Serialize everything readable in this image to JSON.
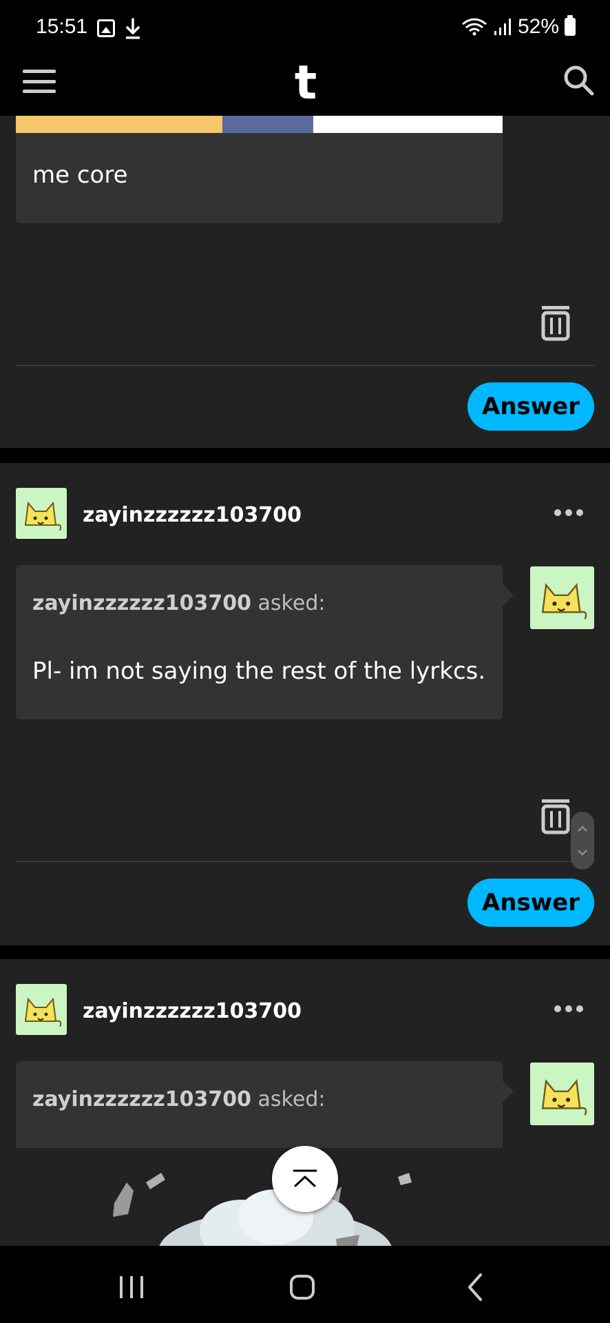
{
  "status_bar": {
    "time": "15:51",
    "battery": "52%",
    "icons": [
      "image-icon",
      "download-icon",
      "wifi-icon",
      "signal-icon",
      "battery-icon"
    ]
  },
  "app_bar": {
    "logo": "t",
    "icons": [
      "menu-icon",
      "tumblr-logo",
      "search-icon"
    ]
  },
  "posts": [
    {
      "text": "me core",
      "answer_label": "Answer"
    },
    {
      "username": "zayinzzzzzz103700",
      "asker": "zayinzzzzzz103700",
      "asked_label": "asked:",
      "text": "Pl- im not saying the rest of the lyrkcs.",
      "answer_label": "Answer"
    },
    {
      "username": "zayinzzzzzz103700",
      "asker": "zayinzzzzzz103700",
      "asked_label": "asked:"
    }
  ],
  "colors": {
    "accent": "#00b8ff",
    "card_bg": "#222222",
    "bubble_bg": "#333333",
    "avatar_bg": "#ccf5c4"
  }
}
